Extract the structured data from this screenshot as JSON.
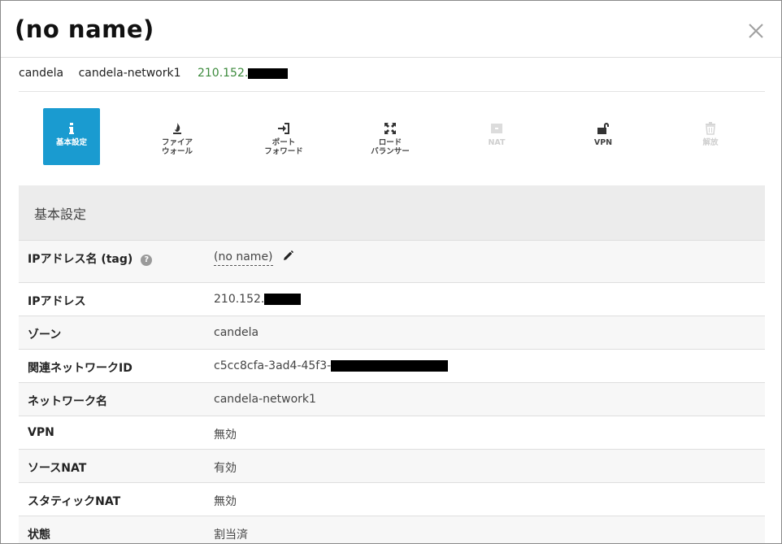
{
  "dialog": {
    "title": "(no name)"
  },
  "info": {
    "zone": "candela",
    "network": "candela-network1",
    "ip_prefix": "210.152."
  },
  "tabs": [
    {
      "id": "basic",
      "label": "基本設定",
      "icon": "info-icon",
      "state": "active"
    },
    {
      "id": "firewall",
      "label": "ファイア\nウォール",
      "icon": "fire-icon",
      "state": "normal"
    },
    {
      "id": "port-forward",
      "label": "ポート\nフォワード",
      "icon": "sign-in-icon",
      "state": "normal"
    },
    {
      "id": "load-balancer",
      "label": "ロード\nバランサー",
      "icon": "expand-icon",
      "state": "normal"
    },
    {
      "id": "nat",
      "label": "NAT",
      "icon": "square-icon",
      "state": "disabled"
    },
    {
      "id": "vpn",
      "label": "VPN",
      "icon": "unlock-icon",
      "state": "normal"
    },
    {
      "id": "release",
      "label": "解放",
      "icon": "trash-icon",
      "state": "disabled"
    }
  ],
  "section": {
    "title": "基本設定"
  },
  "rows": [
    {
      "label": "IPアドレス名 (tag)",
      "value": "(no name)"
    },
    {
      "label": "IPアドレス",
      "value": "210.152."
    },
    {
      "label": "ゾーン",
      "value": "candela"
    },
    {
      "label": "関連ネットワークID",
      "value": "c5cc8cfa-3ad4-45f3-"
    },
    {
      "label": "ネットワーク名",
      "value": "candela-network1"
    },
    {
      "label": "VPN",
      "value": "無効"
    },
    {
      "label": "ソースNAT",
      "value": "有効"
    },
    {
      "label": "スタティックNAT",
      "value": "無効"
    },
    {
      "label": "状態",
      "value": "割当済"
    }
  ],
  "colors": {
    "accent": "#1a9bd0",
    "ip_green": "#3c8a3c",
    "section_bg": "#ececec"
  }
}
